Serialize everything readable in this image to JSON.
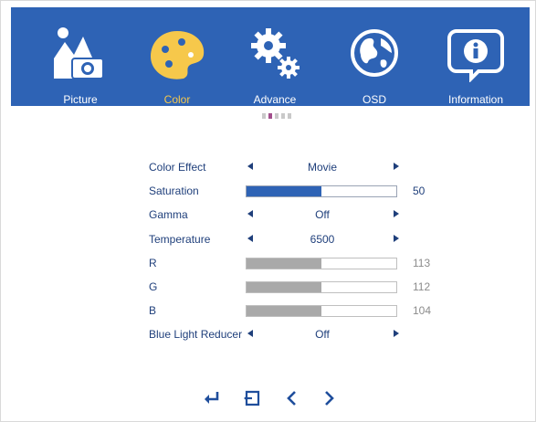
{
  "tabs": [
    {
      "label": "Picture",
      "icon": "picture-icon",
      "active": false
    },
    {
      "label": "Color",
      "icon": "color-palette-icon",
      "active": true
    },
    {
      "label": "Advance",
      "icon": "gears-icon",
      "active": false
    },
    {
      "label": "OSD",
      "icon": "globe-icon",
      "active": false
    },
    {
      "label": "Information",
      "icon": "info-icon",
      "active": false
    }
  ],
  "page_dots": {
    "count": 5,
    "active_index": 1
  },
  "menu": {
    "color_effect": {
      "label": "Color Effect",
      "value": "Movie"
    },
    "saturation": {
      "label": "Saturation",
      "value": "50",
      "level_percent": 50
    },
    "gamma": {
      "label": "Gamma",
      "value": "Off"
    },
    "temperature": {
      "label": "Temperature",
      "value": "6500"
    },
    "r": {
      "label": "R",
      "value": "113",
      "level_percent": 50
    },
    "g": {
      "label": "G",
      "value": "112",
      "level_percent": 50
    },
    "b": {
      "label": "B",
      "value": "104",
      "level_percent": 50
    },
    "blue_light_reducer": {
      "label": "Blue Light Reducer",
      "value": "Off"
    }
  },
  "bottom_nav": [
    "enter-icon",
    "exit-icon",
    "left-chevron-icon",
    "right-chevron-icon"
  ],
  "colors": {
    "header_blue": "#2e63b5",
    "active_label": "#f6c84b",
    "text": "#1f3f7b",
    "page_dot_active": "#a24e8c"
  }
}
